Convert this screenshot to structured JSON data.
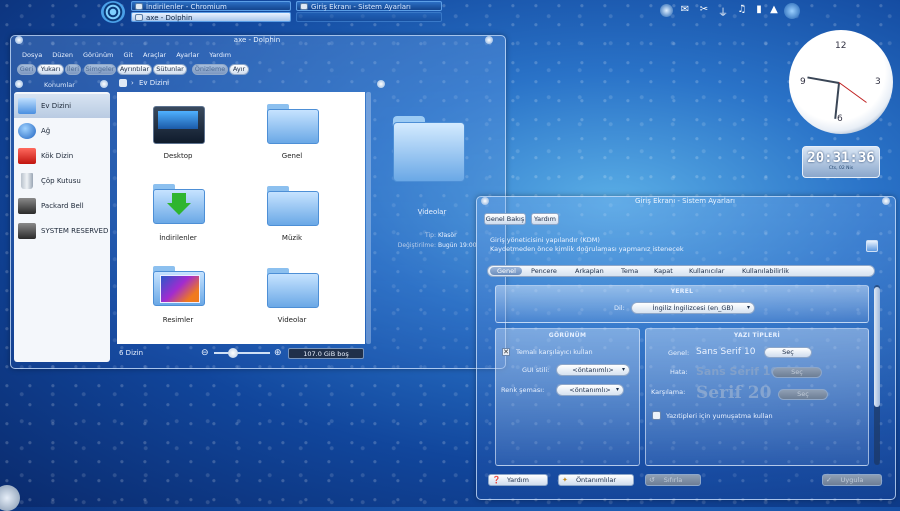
{
  "taskbar": {
    "tasks": [
      {
        "label": "İndirilenler - Chromium"
      },
      {
        "label": "axe - Dolphin"
      },
      {
        "label": "Giriş Ekranı - Sistem Ayarları"
      }
    ]
  },
  "clock": {
    "analog_numbers": [
      "12",
      "3",
      "6",
      "9"
    ],
    "digital_time": "20:31:36",
    "digital_date": "Cts, 02 Nis"
  },
  "dolphin": {
    "title": "axe - Dolphin",
    "menu": [
      "Dosya",
      "Düzen",
      "Görünüm",
      "Git",
      "Araçlar",
      "Ayarlar",
      "Yardım"
    ],
    "toolbar": {
      "back": "Geri",
      "up": "Yukarı",
      "forward": "İleri",
      "icons": "Simgeler",
      "details": "Ayrıntılar",
      "columns": "Sütunlar",
      "preview": "Önizleme",
      "split": "Ayır"
    },
    "places_header": "Konumlar",
    "breadcrumb": "Ev Dizini",
    "places": [
      {
        "label": "Ev Dizini",
        "icon": "home-folder-icon",
        "color": "#4a8fe0"
      },
      {
        "label": "Ağ",
        "icon": "network-globe-icon",
        "color": "#2a76d0"
      },
      {
        "label": "Kök Dizin",
        "icon": "red-folder-icon",
        "color": "#d0221e"
      },
      {
        "label": "Çöp Kutusu",
        "icon": "trash-icon",
        "color": "#9aa6b4"
      },
      {
        "label": "Packard Bell",
        "icon": "drive-icon",
        "color": "#444"
      },
      {
        "label": "SYSTEM RESERVED",
        "icon": "drive-icon",
        "color": "#444"
      }
    ],
    "files": [
      {
        "label": "Desktop",
        "icon": "desktop-folder-icon"
      },
      {
        "label": "Genel",
        "icon": "folder-icon"
      },
      {
        "label": "İndirilenler",
        "icon": "downloads-folder-icon"
      },
      {
        "label": "Müzik",
        "icon": "folder-icon"
      },
      {
        "label": "Resimler",
        "icon": "pictures-folder-icon"
      },
      {
        "label": "Videolar",
        "icon": "folder-icon"
      }
    ],
    "status_count": "6 Dizin",
    "free_space": "107.0 GiB boş",
    "info": {
      "name": "Videolar",
      "type_label": "Tip:",
      "type_value": "Klasör",
      "modified_label": "Değiştirilme:",
      "modified_value": "Bugün 19:00"
    }
  },
  "settings": {
    "title": "Giriş Ekranı - Sistem Ayarları",
    "overview_button": "Genel Bakış",
    "help_top_button": "Yardım",
    "description_1": "Giriş yöneticisini yapılandır (KDM)",
    "description_2": "Kaydetmeden önce kimlik doğrulaması yapmanız istenecek",
    "tabs": [
      "Genel",
      "Pencere",
      "Arkaplan",
      "Tema",
      "Kapat",
      "Kullanıcılar",
      "Kullanılabilirlik"
    ],
    "active_tab": "Genel",
    "locale_section": "YEREL",
    "language_label": "Dil:",
    "language_value": "İngiliz İngilizcesi (en_GB)",
    "appearance_section": "GÖRÜNÜM",
    "themed_greeter_label": "Temalı karşılayıcı kullan",
    "themed_greeter_checked": true,
    "gui_style_label": "GUI stili:",
    "gui_style_value": "<öntanımlı>",
    "color_scheme_label": "Renk şeması:",
    "color_scheme_value": "<öntanımlı>",
    "fonts_section": "YAZI TİPLERİ",
    "general_font_label": "Genel:",
    "general_font_value": "Sans Serif 10",
    "failure_font_label": "Hata:",
    "failure_font_value": "Sans Serif 10",
    "greeting_font_label": "Karşılama:",
    "greeting_font_value": "Serif 20",
    "choose_button": "Seç",
    "antialias_label": "Yazıtipleri için yumuşatma kullan",
    "antialias_checked": false,
    "bottom_help": "Yardım",
    "defaults": "Öntanımlılar",
    "reset": "Sıfırla",
    "apply": "Uygula"
  }
}
